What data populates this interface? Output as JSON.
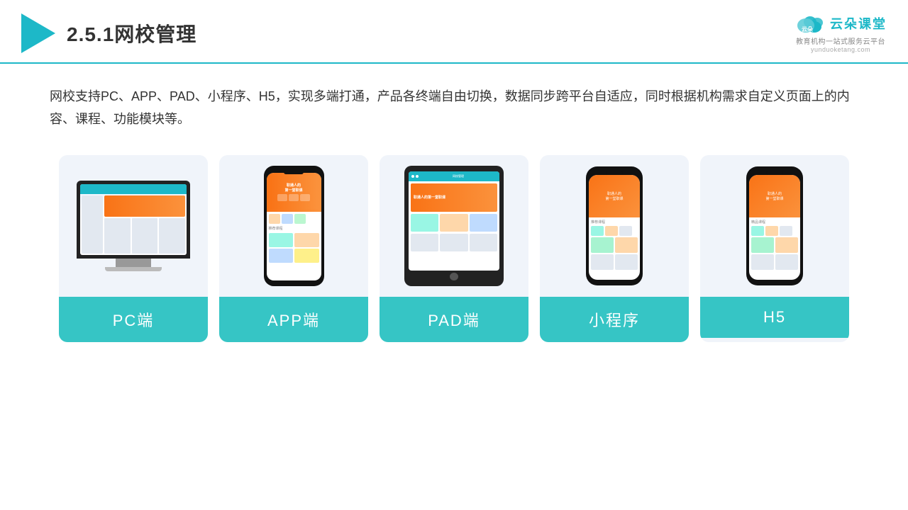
{
  "header": {
    "title": "2.5.1网校管理",
    "brand_name": "云朵课堂",
    "brand_url": "yunduoketang.com",
    "brand_tagline": "教育机构一站式服务云平台"
  },
  "description": {
    "text": "网校支持PC、APP、PAD、小程序、H5，实现多端打通，产品各终端自由切换，数据同步跨平台自适应，同时根据机构需求自定义页面上的内容、课程、功能模块等。"
  },
  "cards": [
    {
      "id": "pc",
      "label": "PC端"
    },
    {
      "id": "app",
      "label": "APP端"
    },
    {
      "id": "pad",
      "label": "PAD端"
    },
    {
      "id": "miniprogram",
      "label": "小程序"
    },
    {
      "id": "h5",
      "label": "H5"
    }
  ],
  "colors": {
    "teal": "#36c5c5",
    "accent": "#1db8c8",
    "text_dark": "#333333",
    "card_bg": "#f0f4fa"
  }
}
